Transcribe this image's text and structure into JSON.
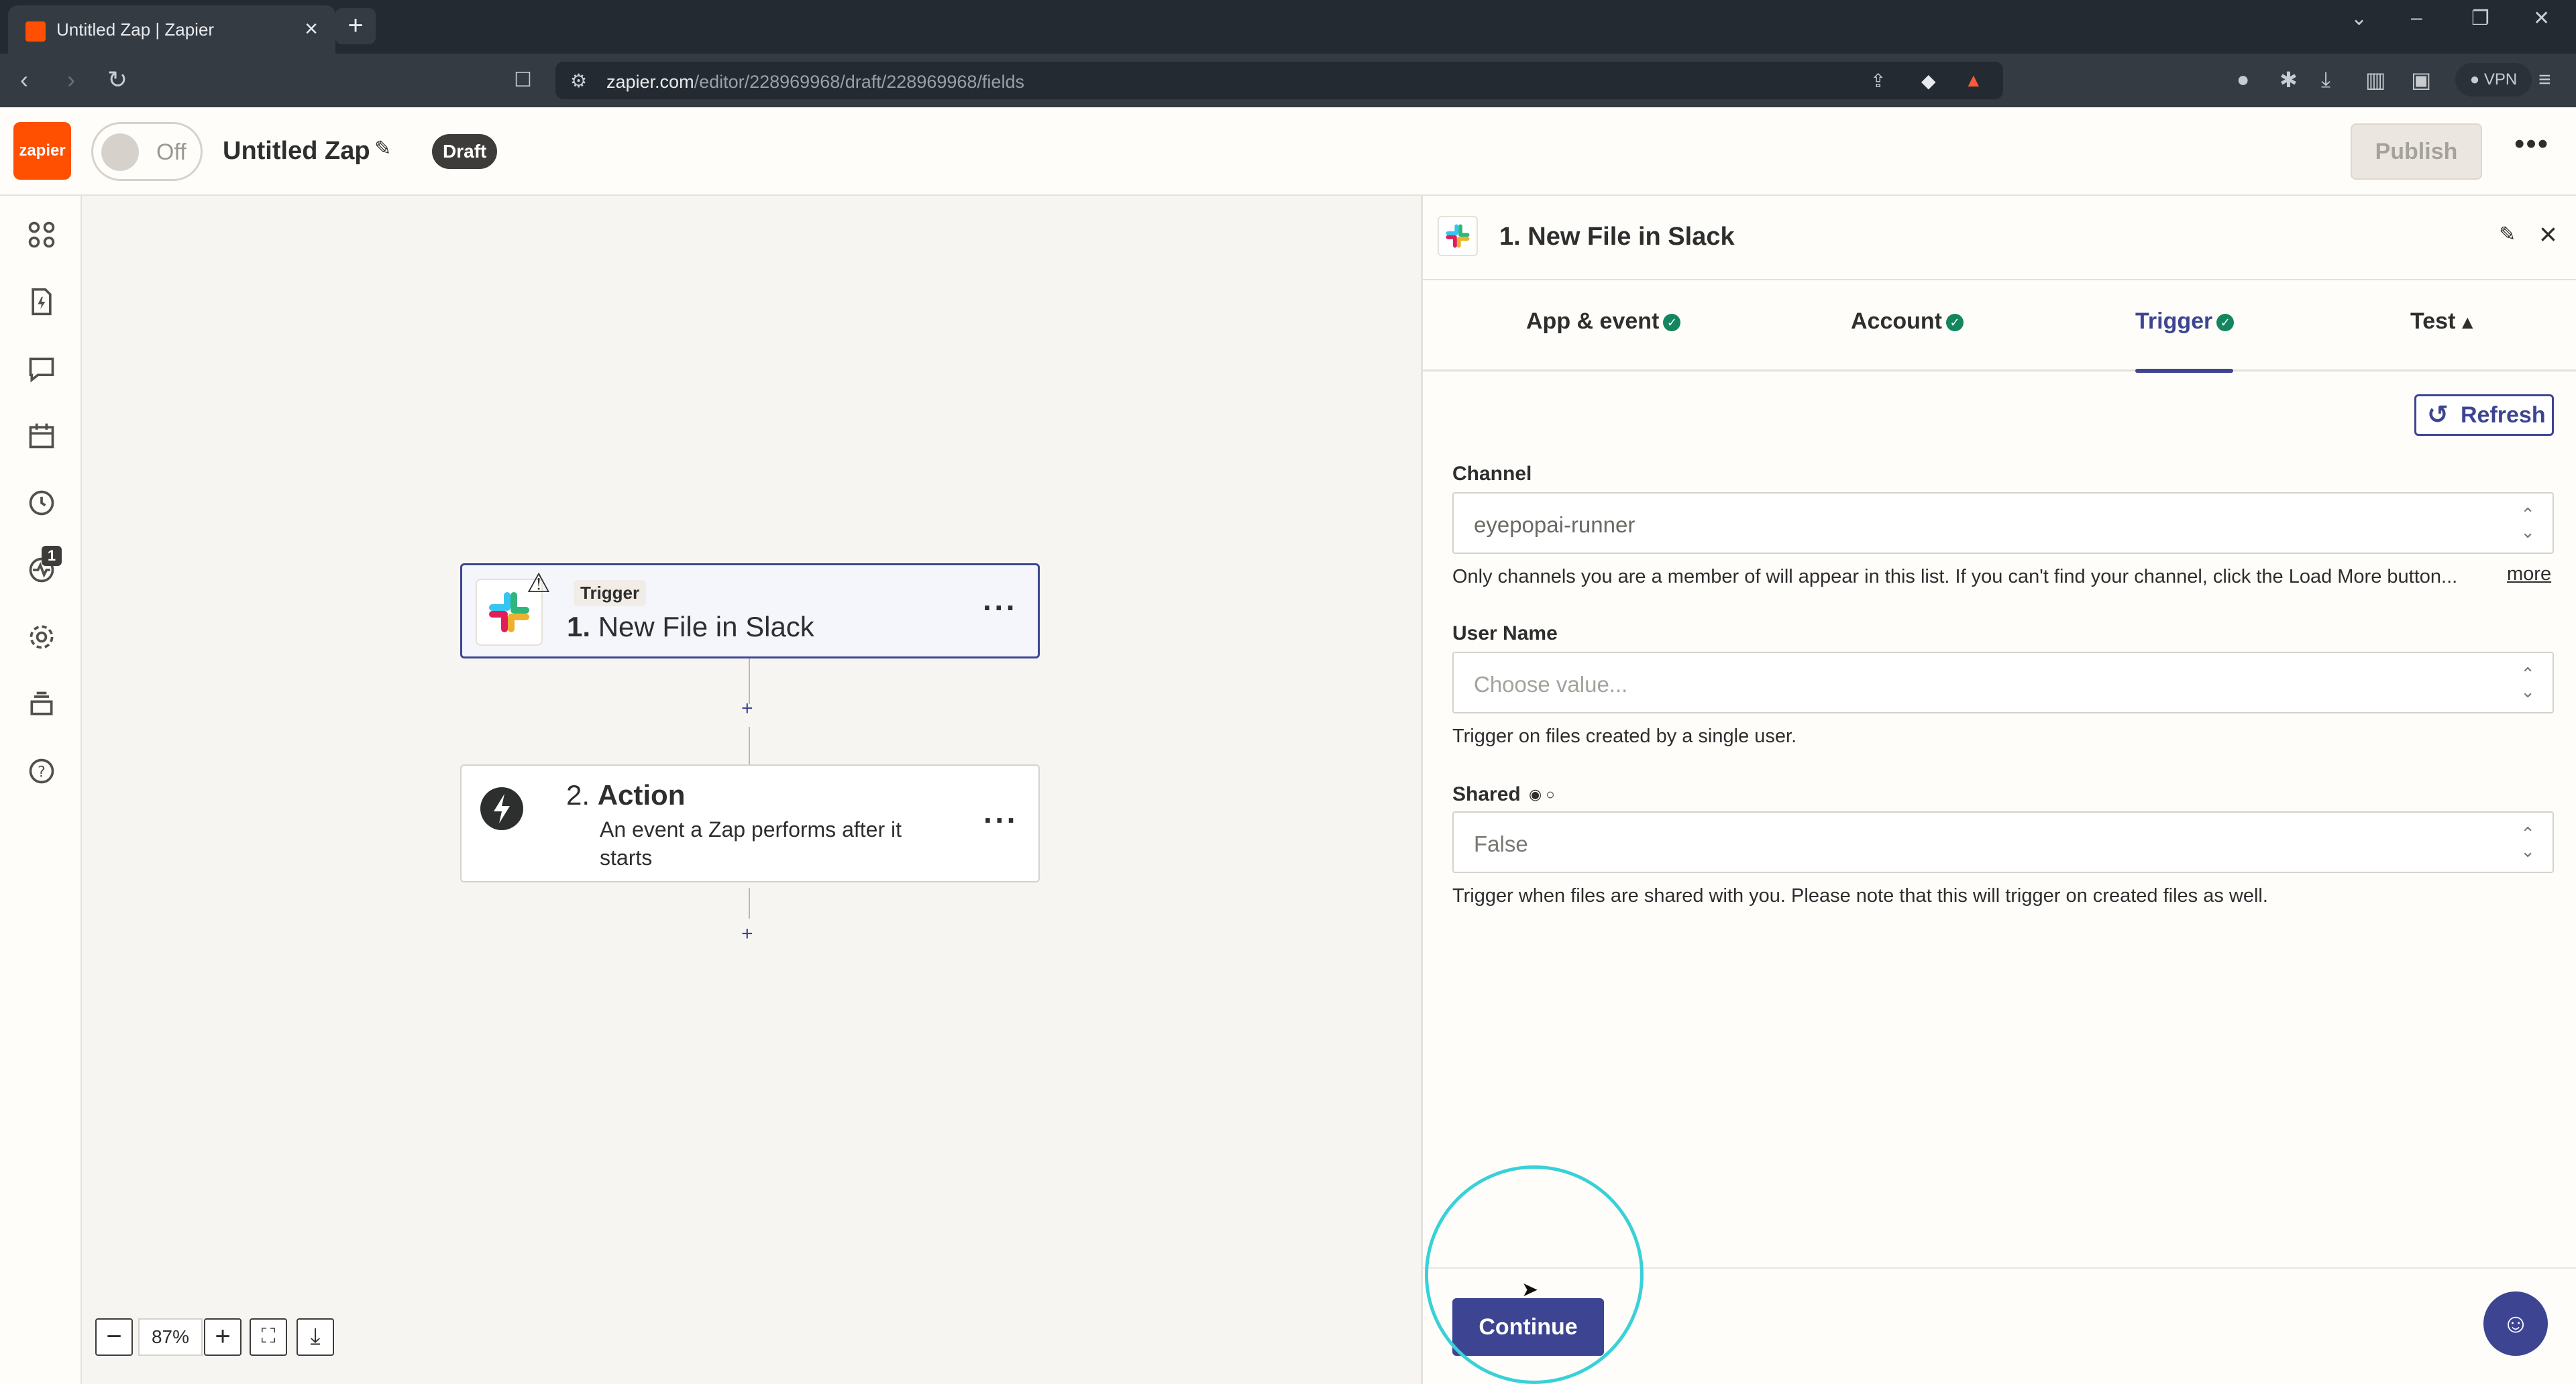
{
  "browser": {
    "tab_title": "Untitled Zap | Zapier",
    "url_host": "zapier.com",
    "url_path": "/editor/228969968/draft/228969968/fields",
    "vpn_label": "VPN"
  },
  "header": {
    "logo_text": "zapier",
    "toggle_label": "Off",
    "zap_title": "Untitled Zap",
    "status_badge": "Draft",
    "publish_label": "Publish"
  },
  "rail": {
    "notification_count": "1"
  },
  "canvas": {
    "trigger_card": {
      "tag": "Trigger",
      "number": "1.",
      "title": "New File in Slack"
    },
    "action_card": {
      "number": "2.",
      "title": "Action",
      "subtitle": "An event a Zap performs after it starts"
    },
    "zoom_level": "87%"
  },
  "panel": {
    "title": "1. New File in Slack",
    "tabs": [
      {
        "label": "App & event",
        "status": "complete"
      },
      {
        "label": "Account",
        "status": "complete"
      },
      {
        "label": "Trigger",
        "status": "complete",
        "active": true
      },
      {
        "label": "Test",
        "status": "warning"
      }
    ],
    "refresh_label": "Refresh",
    "fields": {
      "channel": {
        "label": "Channel",
        "value": "eyepopai-runner",
        "help": "Only channels you are a member of will appear in this list. If you can't find your channel, click the Load More button...",
        "more_link": "more"
      },
      "user_name": {
        "label": "User Name",
        "placeholder": "Choose value...",
        "help": "Trigger on files created by a single user."
      },
      "shared": {
        "label": "Shared",
        "value": "False",
        "help": "Trigger when files are shared with you. Please note that this will trigger on created files as well."
      }
    },
    "continue_label": "Continue"
  },
  "colors": {
    "brand": "#ff4f00",
    "primary": "#3d4592",
    "success": "#13855f",
    "highlight_ring": "#38d1d8"
  }
}
